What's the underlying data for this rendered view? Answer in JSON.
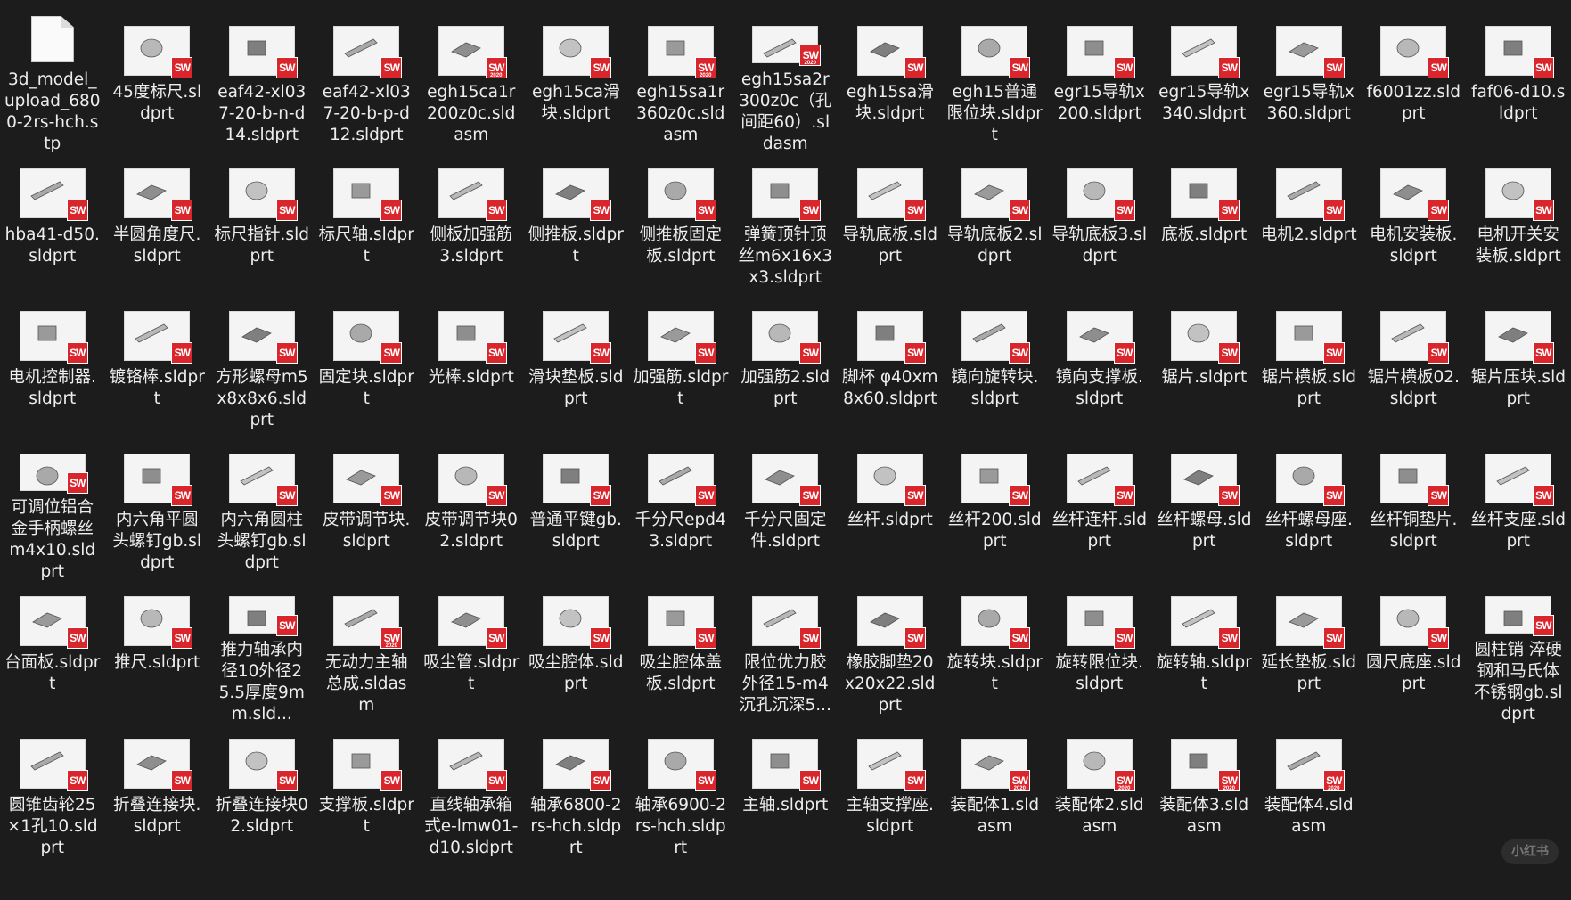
{
  "files": [
    {
      "name": "3d_model_upload_6800-2rs-hch.stp",
      "icon": "generic-file-icon"
    },
    {
      "name": "45度标尺.sldprt",
      "icon": "solidworks-part-icon"
    },
    {
      "name": "eaf42-xl037-20-b-n-d14.sldprt",
      "icon": "solidworks-part-icon"
    },
    {
      "name": "eaf42-xl037-20-b-p-d12.sldprt",
      "icon": "solidworks-part-icon"
    },
    {
      "name": "egh15ca1r200z0c.sldasm",
      "icon": "solidworks-assembly-icon"
    },
    {
      "name": "egh15ca滑块.sldprt",
      "icon": "solidworks-part-icon"
    },
    {
      "name": "egh15sa1r360z0c.sldasm",
      "icon": "solidworks-assembly-icon"
    },
    {
      "name": "egh15sa2r300z0c（孔间距60）.sldasm",
      "icon": "solidworks-assembly-icon"
    },
    {
      "name": "egh15sa滑块.sldprt",
      "icon": "solidworks-part-icon"
    },
    {
      "name": "egh15普通限位块.sldprt",
      "icon": "solidworks-part-icon"
    },
    {
      "name": "egr15导轨x200.sldprt",
      "icon": "solidworks-part-icon"
    },
    {
      "name": "egr15导轨x340.sldprt",
      "icon": "solidworks-part-icon"
    },
    {
      "name": "egr15导轨x360.sldprt",
      "icon": "solidworks-part-icon"
    },
    {
      "name": "f6001zz.sldprt",
      "icon": "solidworks-part-icon"
    },
    {
      "name": "faf06-d10.sldprt",
      "icon": "solidworks-part-icon"
    },
    {
      "name": "hba41-d50.sldprt",
      "icon": "solidworks-part-icon"
    },
    {
      "name": "半圆角度尺.sldprt",
      "icon": "solidworks-part-icon"
    },
    {
      "name": "标尺指针.sldprt",
      "icon": "solidworks-part-icon"
    },
    {
      "name": "标尺轴.sldprt",
      "icon": "solidworks-part-icon"
    },
    {
      "name": "侧板加强筋3.sldprt",
      "icon": "solidworks-part-icon"
    },
    {
      "name": "侧推板.sldprt",
      "icon": "solidworks-part-icon"
    },
    {
      "name": "侧推板固定板.sldprt",
      "icon": "solidworks-part-icon"
    },
    {
      "name": "弹簧顶针顶丝m6x16x3x3.sldprt",
      "icon": "solidworks-part-icon"
    },
    {
      "name": "导轨底板.sldprt",
      "icon": "solidworks-part-icon"
    },
    {
      "name": "导轨底板2.sldprt",
      "icon": "solidworks-part-icon"
    },
    {
      "name": "导轨底板3.sldprt",
      "icon": "solidworks-part-icon"
    },
    {
      "name": "底板.sldprt",
      "icon": "solidworks-part-icon"
    },
    {
      "name": "电机2.sldprt",
      "icon": "solidworks-part-icon"
    },
    {
      "name": "电机安装板.sldprt",
      "icon": "solidworks-part-icon"
    },
    {
      "name": "电机开关安装板.sldprt",
      "icon": "solidworks-part-icon"
    },
    {
      "name": "电机控制器.sldprt",
      "icon": "solidworks-part-icon"
    },
    {
      "name": "镀铬棒.sldprt",
      "icon": "solidworks-part-icon"
    },
    {
      "name": "方形螺母m5x8x8x6.sldprt",
      "icon": "solidworks-part-icon"
    },
    {
      "name": "固定块.sldprt",
      "icon": "solidworks-part-icon"
    },
    {
      "name": "光棒.sldprt",
      "icon": "solidworks-part-icon"
    },
    {
      "name": "滑块垫板.sldprt",
      "icon": "solidworks-part-icon"
    },
    {
      "name": "加强筋.sldprt",
      "icon": "solidworks-part-icon"
    },
    {
      "name": "加强筋2.sldprt",
      "icon": "solidworks-part-icon"
    },
    {
      "name": "脚杯 φ40xm8x60.sldprt",
      "icon": "solidworks-part-icon"
    },
    {
      "name": "镜向旋转块.sldprt",
      "icon": "solidworks-part-icon"
    },
    {
      "name": "镜向支撑板.sldprt",
      "icon": "solidworks-part-icon"
    },
    {
      "name": "锯片.sldprt",
      "icon": "solidworks-part-icon"
    },
    {
      "name": "锯片横板.sldprt",
      "icon": "solidworks-part-icon"
    },
    {
      "name": "锯片横板02.sldprt",
      "icon": "solidworks-part-icon"
    },
    {
      "name": "锯片压块.sldprt",
      "icon": "solidworks-part-icon"
    },
    {
      "name": "可调位铝合金手柄螺丝m4x10.sldprt",
      "icon": "solidworks-part-icon"
    },
    {
      "name": "内六角平圆头螺钉gb.sldprt",
      "icon": "solidworks-part-icon"
    },
    {
      "name": "内六角圆柱头螺钉gb.sldprt",
      "icon": "solidworks-part-icon"
    },
    {
      "name": "皮带调节块.sldprt",
      "icon": "solidworks-part-icon"
    },
    {
      "name": "皮带调节块02.sldprt",
      "icon": "solidworks-part-icon"
    },
    {
      "name": "普通平键gb.sldprt",
      "icon": "solidworks-part-icon"
    },
    {
      "name": "千分尺epd43.sldprt",
      "icon": "solidworks-part-icon"
    },
    {
      "name": "千分尺固定件.sldprt",
      "icon": "solidworks-part-icon"
    },
    {
      "name": "丝杆.sldprt",
      "icon": "solidworks-part-icon"
    },
    {
      "name": "丝杆200.sldprt",
      "icon": "solidworks-part-icon"
    },
    {
      "name": "丝杆连杆.sldprt",
      "icon": "solidworks-part-icon"
    },
    {
      "name": "丝杆螺母.sldprt",
      "icon": "solidworks-part-icon"
    },
    {
      "name": "丝杆螺母座.sldprt",
      "icon": "solidworks-part-icon"
    },
    {
      "name": "丝杆铜垫片.sldprt",
      "icon": "solidworks-part-icon"
    },
    {
      "name": "丝杆支座.sldprt",
      "icon": "solidworks-part-icon"
    },
    {
      "name": "台面板.sldprt",
      "icon": "solidworks-part-icon"
    },
    {
      "name": "推尺.sldprt",
      "icon": "solidworks-part-icon"
    },
    {
      "name": "推力轴承内径10外径25.5厚度9mm.sld...",
      "icon": "solidworks-part-icon"
    },
    {
      "name": "无动力主轴总成.sldasm",
      "icon": "solidworks-assembly-icon"
    },
    {
      "name": "吸尘管.sldprt",
      "icon": "solidworks-part-icon"
    },
    {
      "name": "吸尘腔体.sldprt",
      "icon": "solidworks-part-icon"
    },
    {
      "name": "吸尘腔体盖板.sldprt",
      "icon": "solidworks-part-icon"
    },
    {
      "name": "限位优力胶外径15-m4沉孔沉深5...",
      "icon": "solidworks-part-icon"
    },
    {
      "name": "橡胶脚垫20x20x22.sldprt",
      "icon": "solidworks-part-icon"
    },
    {
      "name": "旋转块.sldprt",
      "icon": "solidworks-part-icon"
    },
    {
      "name": "旋转限位块.sldprt",
      "icon": "solidworks-part-icon"
    },
    {
      "name": "旋转轴.sldprt",
      "icon": "solidworks-part-icon"
    },
    {
      "name": "延长垫板.sldprt",
      "icon": "solidworks-part-icon"
    },
    {
      "name": "圆尺底座.sldprt",
      "icon": "solidworks-part-icon"
    },
    {
      "name": "圆柱销 淬硬钢和马氏体不锈钢gb.sldprt",
      "icon": "solidworks-part-icon"
    },
    {
      "name": "圆锥齿轮25×1孔10.sldprt",
      "icon": "solidworks-part-icon"
    },
    {
      "name": "折叠连接块.sldprt",
      "icon": "solidworks-part-icon"
    },
    {
      "name": "折叠连接块02.sldprt",
      "icon": "solidworks-part-icon"
    },
    {
      "name": "支撑板.sldprt",
      "icon": "solidworks-part-icon"
    },
    {
      "name": "直线轴承箱式e-lmw01-d10.sldprt",
      "icon": "solidworks-part-icon"
    },
    {
      "name": "轴承6800-2rs-hch.sldprt",
      "icon": "solidworks-part-icon"
    },
    {
      "name": "轴承6900-2rs-hch.sldprt",
      "icon": "solidworks-part-icon"
    },
    {
      "name": "主轴.sldprt",
      "icon": "solidworks-part-icon"
    },
    {
      "name": "主轴支撑座.sldprt",
      "icon": "solidworks-part-icon"
    },
    {
      "name": "装配体1.sldasm",
      "icon": "solidworks-assembly-icon"
    },
    {
      "name": "装配体2.sldasm",
      "icon": "solidworks-assembly-icon"
    },
    {
      "name": "装配体3.sldasm",
      "icon": "solidworks-assembly-icon"
    },
    {
      "name": "装配体4.sldasm",
      "icon": "solidworks-assembly-icon"
    }
  ],
  "badge_text": "SW",
  "watermark": "小红书",
  "colors": {
    "background": "#1c1c1c",
    "badge": "#d9262c",
    "label": "#ededed"
  }
}
